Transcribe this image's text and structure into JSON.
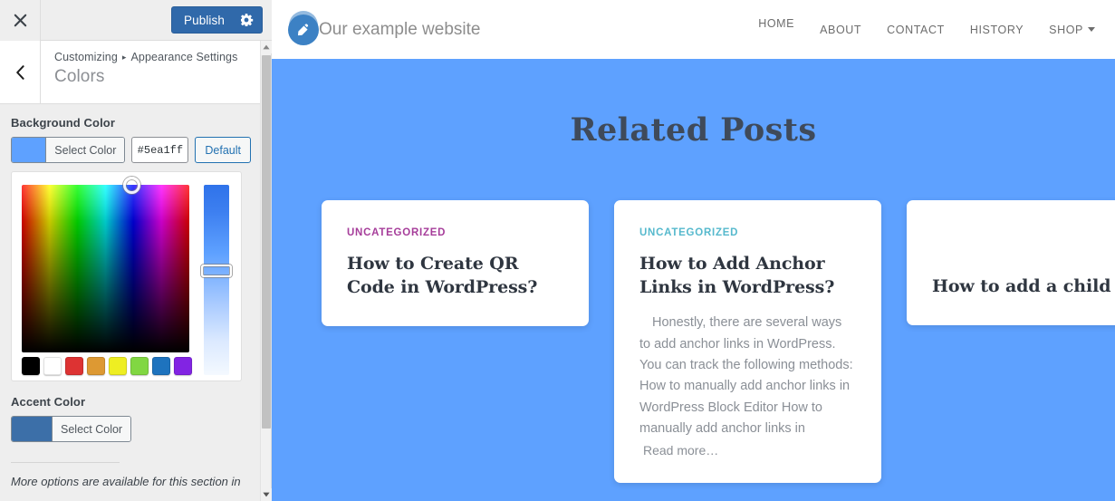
{
  "customizer": {
    "close_icon": "close-x-icon",
    "publish_label": "Publish",
    "gear_icon": "gear-icon",
    "back_icon": "chevron-left-icon",
    "breadcrumb": {
      "root": "Customizing",
      "separator": "▸",
      "parent": "Appearance Settings"
    },
    "section_title": "Colors",
    "background_color": {
      "label": "Background Color",
      "select_label": "Select Color",
      "value": "#5ea1ff",
      "default_label": "Default"
    },
    "accent_color": {
      "label": "Accent Color",
      "select_label": "Select Color",
      "value": "#3c6fa8"
    },
    "palette": [
      {
        "name": "black",
        "hex": "#000000"
      },
      {
        "name": "white",
        "hex": "#ffffff"
      },
      {
        "name": "red",
        "hex": "#dd3333"
      },
      {
        "name": "orange",
        "hex": "#dd9933"
      },
      {
        "name": "yellow",
        "hex": "#eeee22"
      },
      {
        "name": "green",
        "hex": "#81d742"
      },
      {
        "name": "blue",
        "hex": "#1e73be"
      },
      {
        "name": "purple",
        "hex": "#8224e3"
      }
    ],
    "note": "More options are available for this section in"
  },
  "preview": {
    "site_title": "Our example website",
    "logo_icon": "pencil-circle-logo-icon",
    "nav": [
      {
        "label": "HOME",
        "has_caret": false
      },
      {
        "label": "ABOUT",
        "has_caret": false
      },
      {
        "label": "CONTACT",
        "has_caret": false
      },
      {
        "label": "HISTORY",
        "has_caret": false
      },
      {
        "label": "SHOP",
        "has_caret": true
      }
    ],
    "heading": "Related Posts",
    "background_color": "#5ea1ff",
    "cards": [
      {
        "category": "UNCATEGORIZED",
        "category_color": "#a63d9a",
        "title": "How to Create QR Code in WordPress?",
        "excerpt": "",
        "read_more": ""
      },
      {
        "category": "UNCATEGORIZED",
        "category_color": "#56b9cd",
        "title": "How to Add Anchor Links in WordPress?",
        "excerpt": "Honestly, there are several ways to add anchor links in WordPress. You can track the following methods: How to manually add anchor links in WordPress Block Editor How to manually add anchor links in",
        "read_more": "Read more…"
      },
      {
        "category": "",
        "category_color": "",
        "title": "How to add a child category in WordPress",
        "excerpt": "",
        "read_more": ""
      }
    ]
  }
}
